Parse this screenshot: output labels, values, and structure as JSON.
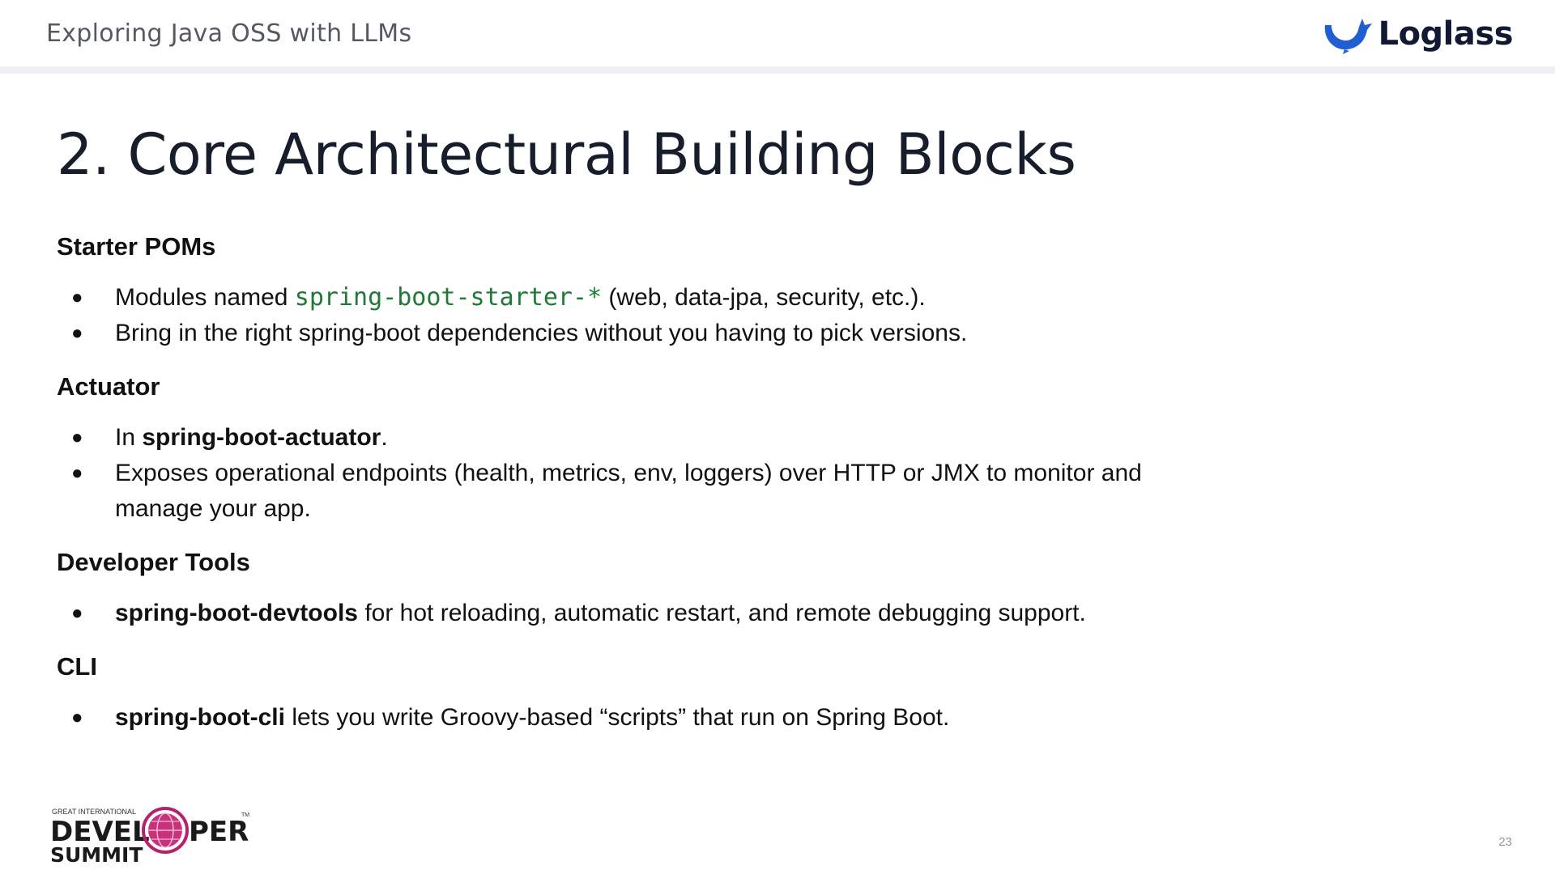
{
  "header": {
    "title": "Exploring Java OSS with LLMs",
    "brand": "Loglass"
  },
  "slide": {
    "title": "2. Core Architectural Building Blocks",
    "sections": [
      {
        "heading": "Starter POMs",
        "bullets": [
          {
            "pre": "Modules named ",
            "code": "spring-boot-starter-*",
            "post": " (web, data-jpa, security, etc.)."
          },
          {
            "text": "Bring in the right spring-boot dependencies without you having to pick versions."
          }
        ]
      },
      {
        "heading": "Actuator",
        "bullets": [
          {
            "pre": "In ",
            "bold": "spring-boot-actuator",
            "post": "."
          },
          {
            "line1": "Exposes operational endpoints (health, metrics, env, loggers) over HTTP or JMX to monitor and",
            "line2": "manage your app."
          }
        ]
      },
      {
        "heading": "Developer Tools",
        "bullets": [
          {
            "bold": "spring-boot-devtools",
            "post": " for hot reloading, automatic restart, and remote debugging support."
          }
        ]
      },
      {
        "heading": "CLI",
        "bullets": [
          {
            "bold": "spring-boot-cli",
            "post": " lets you write Groovy-based “scripts” that run on Spring Boot."
          }
        ]
      }
    ]
  },
  "footer": {
    "logo_top": "GREAT INTERNATIONAL",
    "logo_left": "DEVEL",
    "logo_right": "PER",
    "logo_bottom": "SUMMIT",
    "logo_tm": "TM",
    "page_number": "23"
  },
  "colors": {
    "brand_blue": "#1f5fd1",
    "code_green": "#1e7a35",
    "logo_circle": "#b5216e"
  },
  "icons": {
    "bullet": "●"
  }
}
